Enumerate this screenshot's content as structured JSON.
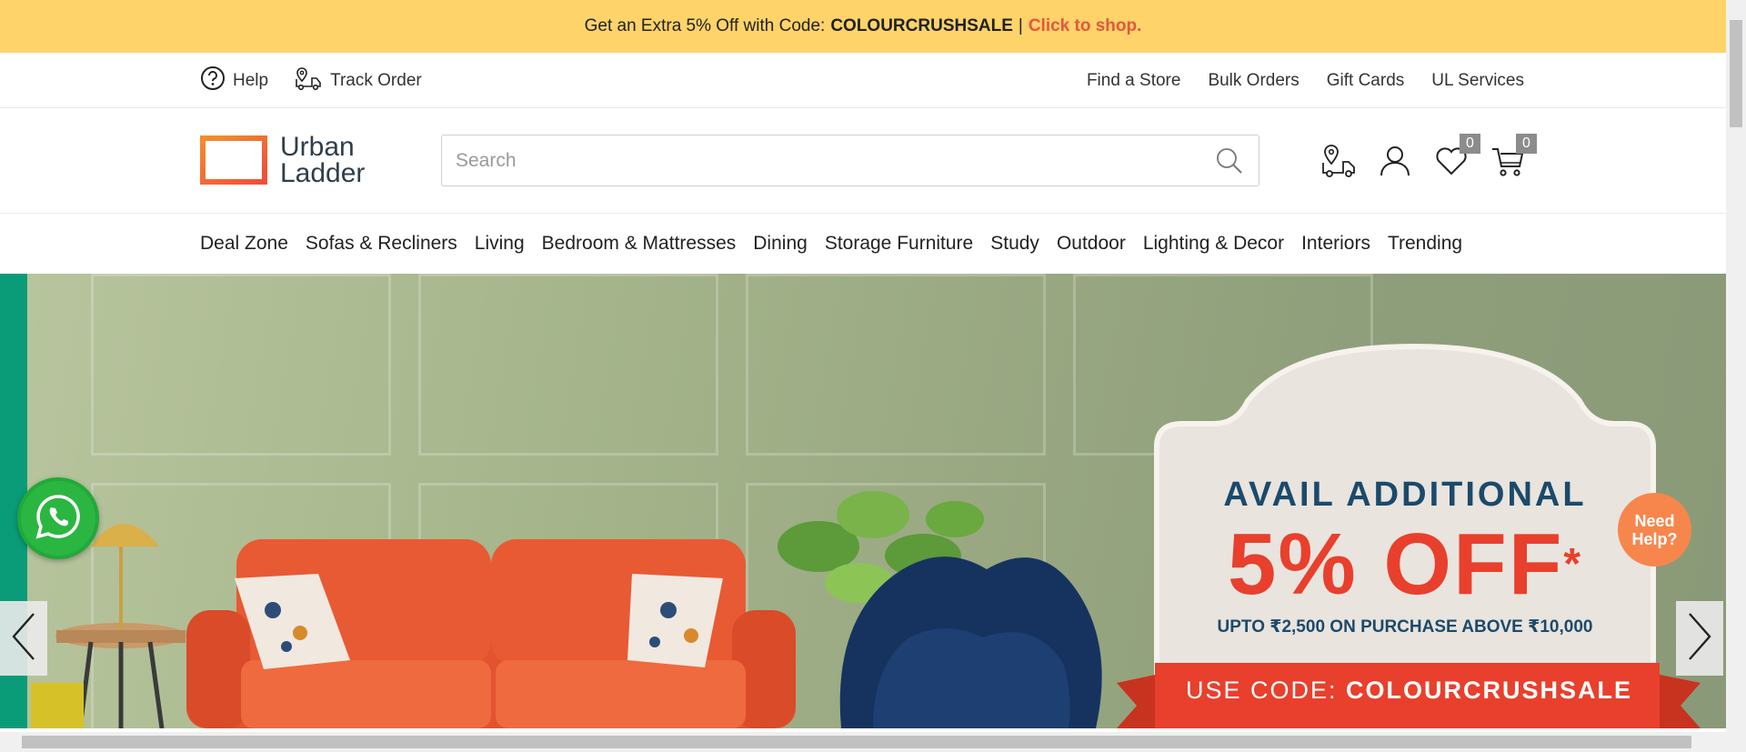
{
  "promo": {
    "text": "Get an Extra 5% Off with Code:",
    "code": "COLOURCRUSHSALE",
    "separator": "|",
    "cta": "Click to shop."
  },
  "utility": {
    "help": "Help",
    "track_order": "Track Order",
    "links": [
      "Find a Store",
      "Bulk Orders",
      "Gift Cards",
      "UL Services"
    ]
  },
  "header": {
    "logo_line1": "Urban",
    "logo_line2": "Ladder",
    "search_placeholder": "Search",
    "wishlist_count": "0",
    "cart_count": "0"
  },
  "nav": {
    "items": [
      "Deal Zone",
      "Sofas & Recliners",
      "Living",
      "Bedroom & Mattresses",
      "Dining",
      "Storage Furniture",
      "Study",
      "Outdoor",
      "Lighting & Decor",
      "Interiors",
      "Trending"
    ]
  },
  "hero": {
    "headline": "AVAIL ADDITIONAL",
    "offer": "5% OFF",
    "asterisk": "*",
    "subtext": "UPTO ₹2,500 ON PURCHASE ABOVE ₹10,000",
    "code_label": "USE CODE:",
    "code_value": "COLOURCRUSHSALE"
  },
  "floating": {
    "need_help_line1": "Need",
    "need_help_line2": "Help?"
  },
  "colors": {
    "promo_bg": "#fdd36a",
    "accent": "#e4573d",
    "brand_orange": "#f26b3a",
    "hero_teal": "#0a9c78",
    "offer_red": "#e8402c",
    "offer_navy": "#1b4a6b"
  }
}
